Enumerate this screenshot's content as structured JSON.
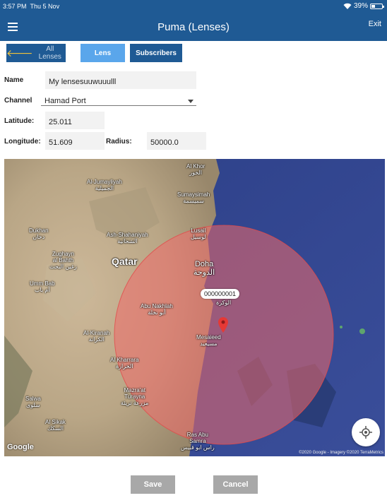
{
  "status_bar": {
    "time": "3:57 PM",
    "date": "Thu 5 Nov",
    "battery": "39%",
    "battery_level": 0.39
  },
  "header": {
    "title": "Puma (Lenses)",
    "exit_label": "Exit",
    "menu_icon": "hamburger-icon"
  },
  "tabs": {
    "back_label": "All Lenses",
    "lens_label": "Lens",
    "subscribers_label": "Subscribers"
  },
  "form": {
    "name_label": "Name",
    "name_value": "My lensesuuwuuulll",
    "channel_label": "Channel",
    "channel_value": "Hamad Port",
    "latitude_label": "Latitude:",
    "latitude_value": "25.011",
    "longitude_label": "Longitude:",
    "longitude_value": "51.609",
    "radius_label": "Radius:",
    "radius_value": "50000.0"
  },
  "map": {
    "places": {
      "al_khor": "Al Khor",
      "al_khor_ar": "الخور",
      "al_jumayliyah": "Al-Jumayliyah",
      "al_jumayliyah_ar": "الجميلية",
      "sumaysimah": "Sumaysimah",
      "sumaysimah_ar": "سميسمة",
      "dukhan": "Dukhan",
      "dukhan_ar": "دخان",
      "ash_shahaniyah": "Ash-Shahaniyah",
      "ash_shahaniyah_ar": "الشحانية",
      "lusail": "Lusail",
      "lusail_ar": "لوسيل",
      "zughayn": "Zughayn",
      "al_bahth": "al Bahth",
      "zughayn_ar": "زغين البحث",
      "qatar": "Qatar",
      "doha": "Doha",
      "doha_ar": "الدوحة",
      "umm_bab": "Umm Bab",
      "umm_bab_ar": "أم باب",
      "abu_nakhlah": "Abu Nakhlah",
      "abu_nakhlah_ar": "أبو نخلة",
      "al_wakrah_ar": "الوكرة",
      "al_kiranah": "Al-Kiranah",
      "al_kiranah_ar": "الكرانة",
      "mesaieed": "Mesaieed",
      "mesaieed_ar": "مسيعيد",
      "al_kharrara": "Al Kharrara",
      "al_kharrara_ar": "الخرارة",
      "mazraat": "Mazra'at",
      "turayna": "Turayna",
      "mazraat_ar": "مزرعة تريئة",
      "salwa": "Salwa",
      "salwa_ar": "سلوى",
      "al_sikak": "Al Sikak",
      "al_sikak_ar": "السكك",
      "ras_abu": "Ras Abu",
      "samra": "Samra",
      "ras_abu_ar": "راس ابو قبيس"
    },
    "marker_label": "000000001",
    "google_label": "Google",
    "attribution": "©2020 Google - Imagery ©2020 TerraMetrics",
    "circle_color": "#f06a6a",
    "pin_color": "#e53935",
    "locate_icon": "crosshair-icon"
  },
  "actions": {
    "save_label": "Save",
    "cancel_label": "Cancel"
  }
}
